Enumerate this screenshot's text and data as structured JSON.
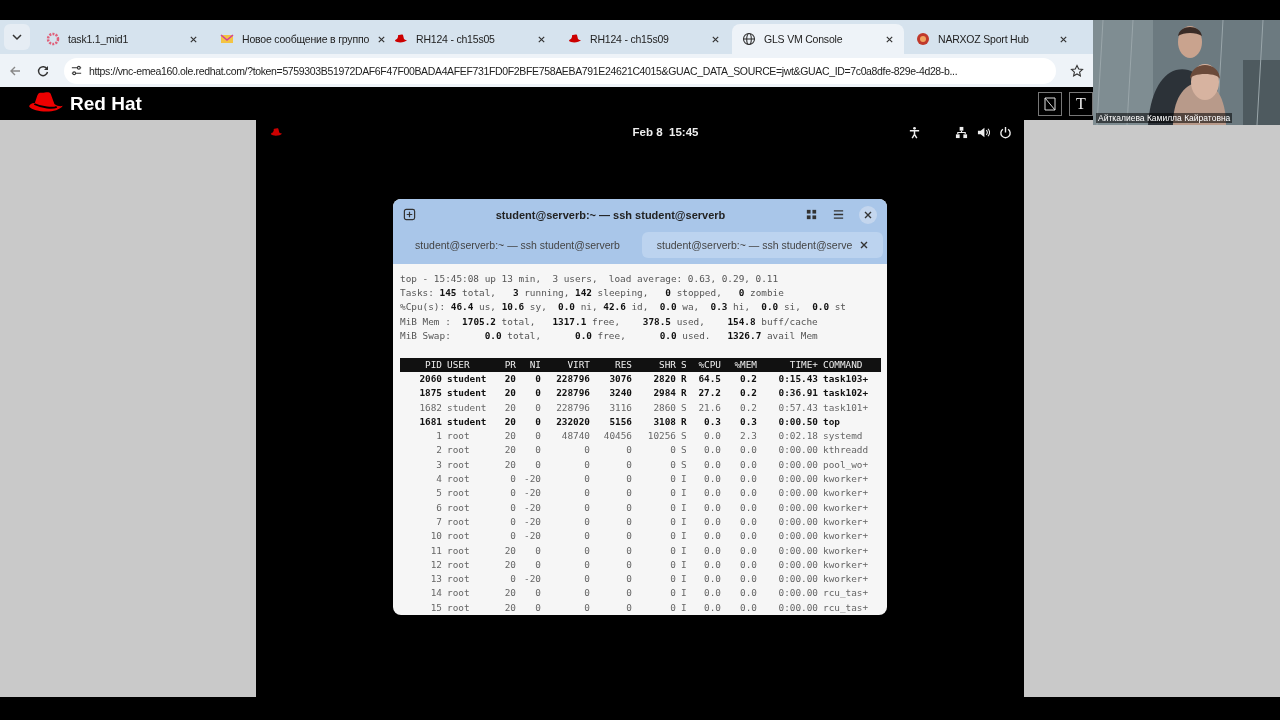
{
  "browser": {
    "tabs": [
      {
        "title": "task1.1_mid1",
        "selected": false
      },
      {
        "title": "Новое сообщение в группо",
        "selected": false
      },
      {
        "title": "RH124 - ch15s05",
        "selected": false
      },
      {
        "title": "RH124 - ch15s09",
        "selected": false
      },
      {
        "title": "GLS VM Console",
        "selected": true
      },
      {
        "title": "NARXOZ Sport Hub",
        "selected": false
      }
    ],
    "url": "https://vnc-emea160.ole.redhat.com/?token=5759303B51972DAF6F47F00BADA4AFEF731FD0F2BFE758AEBA791E24621C4015&GUAC_DATA_SOURCE=jwt&GUAC_ID=7c0a8dfe-829e-4d28-b..."
  },
  "header": {
    "brand": "Red Hat",
    "key_label": "T"
  },
  "desktop": {
    "clock": "Feb 8  15:45"
  },
  "terminal": {
    "title": "student@serverb:~ — ssh student@serverb",
    "tabs": [
      {
        "label": "student@serverb:~ — ssh student@serverb",
        "selected": false
      },
      {
        "label": "student@serverb:~ — ssh student@serve",
        "selected": true
      }
    ],
    "summary": [
      "top - 15:45:08 up 13 min,  3 users,  load average: 0.63, 0.29, 0.11",
      "Tasks: **145** total,   **3** running, **142** sleeping,   **0** stopped,   **0** zombie",
      "%Cpu(s): **46.4** us, **10.6** sy,  **0.0** ni, **42.6** id,  **0.0** wa,  **0.3** hi,  **0.0** si,  **0.0** st",
      "MiB Mem :  **1705.2** total,   **1317.1** free,    **378.5** used,    **154.8** buff/cache",
      "MiB Swap:      **0.0** total,      **0.0** free,      **0.0** used.   **1326.7** avail Mem"
    ],
    "columns": [
      "PID",
      "USER",
      "PR",
      "NI",
      "VIRT",
      "RES",
      "SHR",
      "S",
      "%CPU",
      "%MEM",
      "TIME+",
      "COMMAND"
    ],
    "rows": [
      {
        "bold": true,
        "cells": [
          "2060",
          "student",
          "20",
          "0",
          "228796",
          "3076",
          "2820",
          "R",
          "64.5",
          "0.2",
          "0:15.43",
          "task103+"
        ]
      },
      {
        "bold": true,
        "cells": [
          "1875",
          "student",
          "20",
          "0",
          "228796",
          "3240",
          "2984",
          "R",
          "27.2",
          "0.2",
          "0:36.91",
          "task102+"
        ]
      },
      {
        "bold": false,
        "cells": [
          "1682",
          "student",
          "20",
          "0",
          "228796",
          "3116",
          "2860",
          "S",
          "21.6",
          "0.2",
          "0:57.43",
          "task101+"
        ]
      },
      {
        "bold": true,
        "cells": [
          "1681",
          "student",
          "20",
          "0",
          "232020",
          "5156",
          "3108",
          "R",
          "0.3",
          "0.3",
          "0:00.50",
          "top"
        ]
      },
      {
        "bold": false,
        "cells": [
          "1",
          "root",
          "20",
          "0",
          "48740",
          "40456",
          "10256",
          "S",
          "0.0",
          "2.3",
          "0:02.18",
          "systemd"
        ]
      },
      {
        "bold": false,
        "cells": [
          "2",
          "root",
          "20",
          "0",
          "0",
          "0",
          "0",
          "S",
          "0.0",
          "0.0",
          "0:00.00",
          "kthreadd"
        ]
      },
      {
        "bold": false,
        "cells": [
          "3",
          "root",
          "20",
          "0",
          "0",
          "0",
          "0",
          "S",
          "0.0",
          "0.0",
          "0:00.00",
          "pool_wo+"
        ]
      },
      {
        "bold": false,
        "cells": [
          "4",
          "root",
          "0",
          "-20",
          "0",
          "0",
          "0",
          "I",
          "0.0",
          "0.0",
          "0:00.00",
          "kworker+"
        ]
      },
      {
        "bold": false,
        "cells": [
          "5",
          "root",
          "0",
          "-20",
          "0",
          "0",
          "0",
          "I",
          "0.0",
          "0.0",
          "0:00.00",
          "kworker+"
        ]
      },
      {
        "bold": false,
        "cells": [
          "6",
          "root",
          "0",
          "-20",
          "0",
          "0",
          "0",
          "I",
          "0.0",
          "0.0",
          "0:00.00",
          "kworker+"
        ]
      },
      {
        "bold": false,
        "cells": [
          "7",
          "root",
          "0",
          "-20",
          "0",
          "0",
          "0",
          "I",
          "0.0",
          "0.0",
          "0:00.00",
          "kworker+"
        ]
      },
      {
        "bold": false,
        "cells": [
          "10",
          "root",
          "0",
          "-20",
          "0",
          "0",
          "0",
          "I",
          "0.0",
          "0.0",
          "0:00.00",
          "kworker+"
        ]
      },
      {
        "bold": false,
        "cells": [
          "11",
          "root",
          "20",
          "0",
          "0",
          "0",
          "0",
          "I",
          "0.0",
          "0.0",
          "0:00.00",
          "kworker+"
        ]
      },
      {
        "bold": false,
        "cells": [
          "12",
          "root",
          "20",
          "0",
          "0",
          "0",
          "0",
          "I",
          "0.0",
          "0.0",
          "0:00.00",
          "kworker+"
        ]
      },
      {
        "bold": false,
        "cells": [
          "13",
          "root",
          "0",
          "-20",
          "0",
          "0",
          "0",
          "I",
          "0.0",
          "0.0",
          "0:00.00",
          "kworker+"
        ]
      },
      {
        "bold": false,
        "cells": [
          "14",
          "root",
          "20",
          "0",
          "0",
          "0",
          "0",
          "I",
          "0.0",
          "0.0",
          "0:00.00",
          "rcu_tas+"
        ]
      },
      {
        "bold": false,
        "cells": [
          "15",
          "root",
          "20",
          "0",
          "0",
          "0",
          "0",
          "I",
          "0.0",
          "0.0",
          "0:00.00",
          "rcu_tas+"
        ]
      }
    ]
  },
  "video": {
    "kind": "picture",
    "caption": "Айткалиева Камилла Кайратовна"
  }
}
